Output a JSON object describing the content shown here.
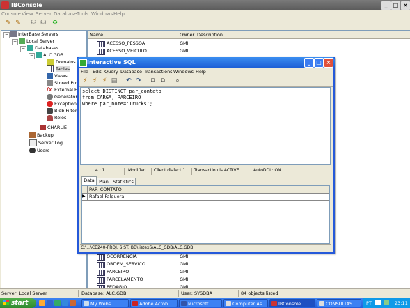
{
  "app": {
    "title": "IBConsole"
  },
  "menu": [
    "Console",
    "View",
    "Server",
    "Database",
    "Tools",
    "Windows",
    "Help"
  ],
  "tree": {
    "root": "InterBase Servers",
    "server": "Local Server",
    "databases": "Databases",
    "db": "ALC.GDB",
    "children": [
      "Domains",
      "Tables",
      "Views",
      "Stored Pro",
      "External Fu",
      "Generators",
      "Exceptions",
      "Blob Filters",
      "Roles"
    ],
    "charlie": "CHARLIE",
    "backup": "Backup",
    "serverlog": "Server Log",
    "users": "Users"
  },
  "list": {
    "headers": [
      "Name",
      "Owner",
      "Description"
    ],
    "top_rows": [
      {
        "name": "ACESSO_PESSOA",
        "owner": "GMI"
      },
      {
        "name": "ACESSO_VEICULO",
        "owner": "GMI"
      }
    ],
    "bottom_rows": [
      {
        "name": "OCORRENCIA",
        "owner": "GMI"
      },
      {
        "name": "ORDEM_SERVICO",
        "owner": "GMI"
      },
      {
        "name": "PARCEIRO",
        "owner": "GMI"
      },
      {
        "name": "PARCELAMENTO",
        "owner": "GMI"
      },
      {
        "name": "PEDAGIO",
        "owner": "GMI"
      }
    ]
  },
  "status": {
    "server": "Server: Local Server",
    "database": "Database: ALC.GDB",
    "user": "User: SYSDBA",
    "count": "84 objects listed"
  },
  "dialog": {
    "title": "Interactive SQL",
    "menu": [
      "File",
      "Edit",
      "Query",
      "Database",
      "Transactions",
      "Windows",
      "Help"
    ],
    "sql": [
      "select DISTINCT par_contato",
      "from CARGA, PARCEIRO",
      "where par_nome='Trucks';"
    ],
    "status": {
      "position": "4 : 1",
      "modified": "Modified",
      "dialect": "Client dialect 1",
      "transaction": "Transaction is ACTIVE.",
      "autoddl": "AutoDDL: ON"
    },
    "tabs": [
      "Data",
      "Plan",
      "Statistics"
    ],
    "grid": {
      "column": "PAR_CONTATO",
      "rows": [
        "Rafael Falguera"
      ]
    },
    "path": "C:\\...\\CE240-PROJ. SIST. BD\\listex6\\ALC_GDB\\ALC.GDB"
  },
  "taskbar": {
    "start": "start",
    "tasks": [
      "My Webs",
      "Adobe Acrob...",
      "Microsoft ...",
      "Computer As...",
      "IBConsole",
      "CONSULTAS..."
    ],
    "lang": "PT",
    "time": "23:11"
  },
  "colors": {
    "xp_blue": "#245edc",
    "start_green": "#3c9a3c",
    "tree_bg": "#ffffff"
  }
}
